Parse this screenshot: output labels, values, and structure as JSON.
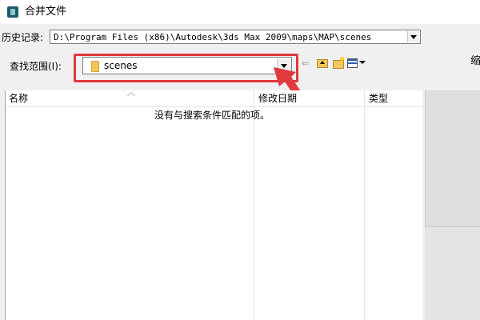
{
  "window": {
    "title": "合并文件"
  },
  "history": {
    "label": "历史记录:",
    "value": "D:\\Program Files (x86)\\Autodesk\\3ds Max 2009\\maps\\MAP\\scenes"
  },
  "lookin": {
    "label": "查找范围(I):",
    "value": "scenes"
  },
  "toolbar": {
    "back_glyph": "⇐",
    "right_partial_text": "缩"
  },
  "filelist": {
    "columns": [
      "名称",
      "修改日期",
      "类型"
    ],
    "empty_message": "没有与搜索条件匹配的项。"
  },
  "colors": {
    "annotation": "#e03a3e",
    "folder": "#f2c75c"
  }
}
